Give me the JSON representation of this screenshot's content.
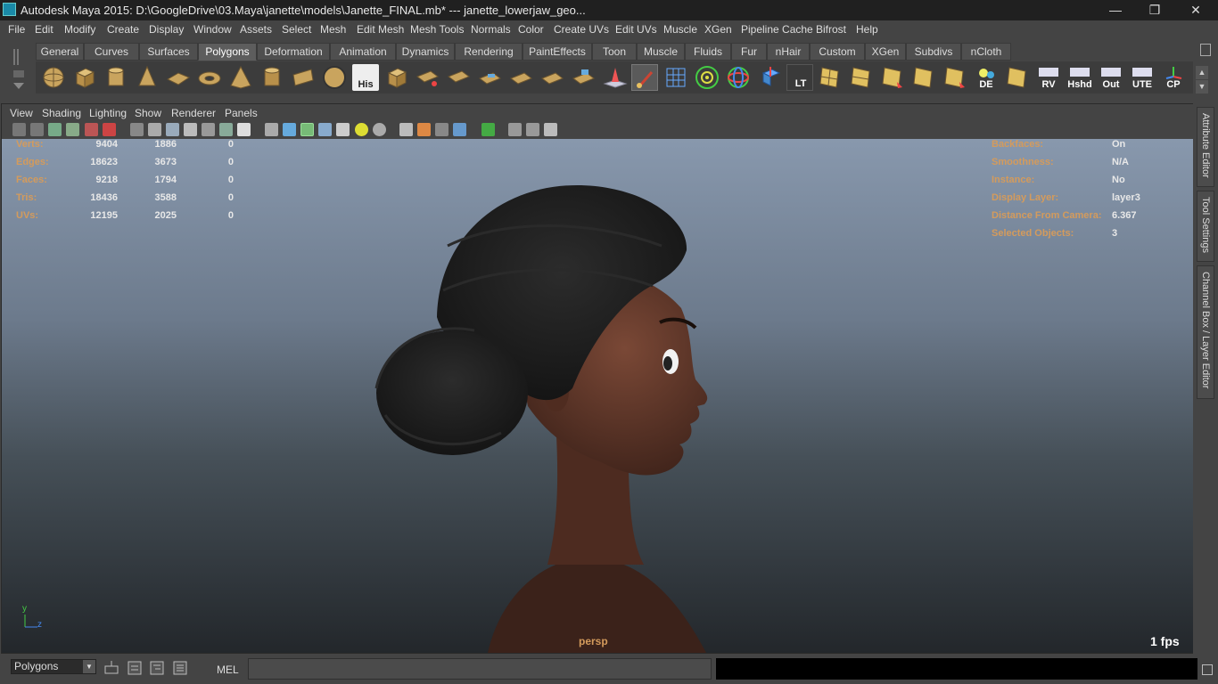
{
  "window": {
    "title": "Autodesk Maya 2015: D:\\GoogleDrive\\03.Maya\\janette\\models\\Janette_FINAL.mb*   ---   janette_lowerjaw_geo...",
    "minimize": "—",
    "restore": "❐",
    "close": "✕"
  },
  "menubar": [
    "File",
    "Edit",
    "Modify",
    "Create",
    "Display",
    "Window",
    "Assets",
    "Select",
    "Mesh",
    "Edit Mesh",
    "Mesh Tools",
    "Normals",
    "Color",
    "Create UVs",
    "Edit UVs",
    "Muscle",
    "XGen",
    "Pipeline Cache",
    "Bifrost",
    "Help"
  ],
  "shelf": {
    "tabs": [
      "General",
      "Curves",
      "Surfaces",
      "Polygons",
      "Deformation",
      "Animation",
      "Dynamics",
      "Rendering",
      "PaintEffects",
      "Toon",
      "Muscle",
      "Fluids",
      "Fur",
      "nHair",
      "Custom",
      "XGen",
      "Subdivs",
      "nCloth"
    ],
    "active_tab": "Polygons",
    "icon_labels": {
      "his": "His",
      "lt": "LT",
      "de": "DE",
      "rv": "RV",
      "hshd": "Hshd",
      "out": "Out",
      "ute": "UTE",
      "cp": "CP"
    }
  },
  "panel_menu": [
    "View",
    "Shading",
    "Lighting",
    "Show",
    "Renderer",
    "Panels"
  ],
  "hud_left": [
    {
      "label": "Verts:",
      "v1": "9404",
      "v2": "1886",
      "v3": "0"
    },
    {
      "label": "Edges:",
      "v1": "18623",
      "v2": "3673",
      "v3": "0"
    },
    {
      "label": "Faces:",
      "v1": "9218",
      "v2": "1794",
      "v3": "0"
    },
    {
      "label": "Tris:",
      "v1": "18436",
      "v2": "3588",
      "v3": "0"
    },
    {
      "label": "UVs:",
      "v1": "12195",
      "v2": "2025",
      "v3": "0"
    }
  ],
  "hud_right": [
    {
      "label": "Backfaces:",
      "value": "On"
    },
    {
      "label": "Smoothness:",
      "value": "N/A"
    },
    {
      "label": "Instance:",
      "value": "No"
    },
    {
      "label": "Display Layer:",
      "value": "layer3"
    },
    {
      "label": "Distance From Camera:",
      "value": "6.367"
    },
    {
      "label": "Selected Objects:",
      "value": "3"
    }
  ],
  "viewport": {
    "camera": "persp",
    "fps": "1 fps",
    "axis_y": "y",
    "axis_z": "z"
  },
  "right_dock": [
    "Attribute Editor",
    "Tool Settings",
    "Channel Box / Layer Editor"
  ],
  "bottom": {
    "mode": "Polygons",
    "mel_label": "MEL",
    "cmd_value": ""
  },
  "colors": {
    "hud_label": "#d49b5c",
    "viewport_top": "#8898ad",
    "viewport_bottom": "#23272b",
    "skin": "#5a3326",
    "hair": "#1d1d1d"
  }
}
